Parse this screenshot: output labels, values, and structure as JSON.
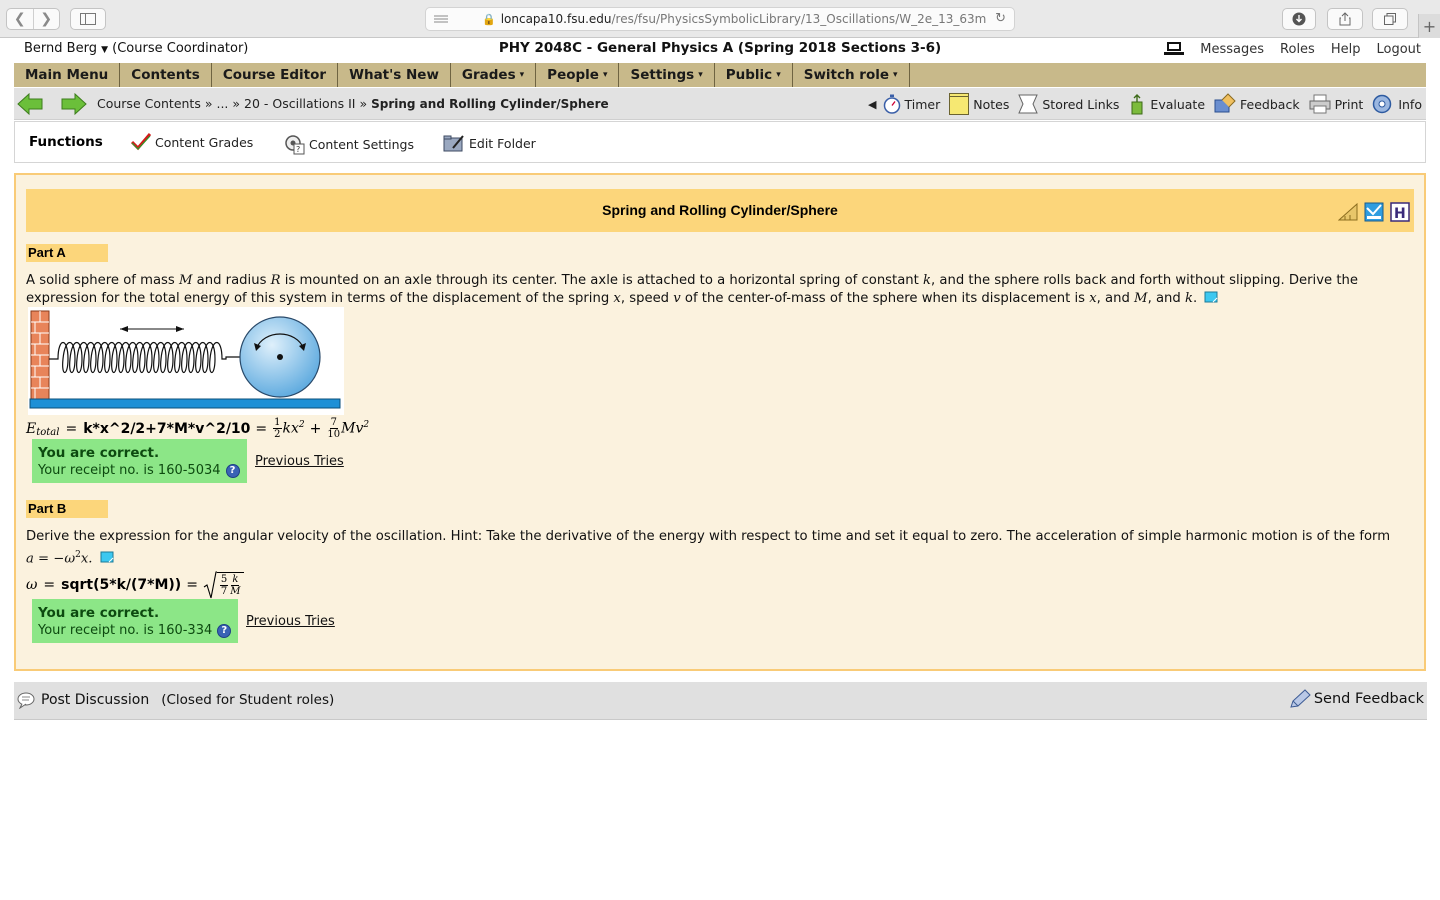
{
  "browser": {
    "url_host": "loncapa10.fsu.edu",
    "url_path": "/res/fsu/PhysicsSymbolicLibrary/13_Oscillations/W_2e_13_63m"
  },
  "header": {
    "user_name": "Bernd Berg",
    "user_role": "(Course Coordinator)",
    "course_title": "PHY 2048C - General Physics A (Spring 2018 Sections 3-6)",
    "links": [
      "Messages",
      "Roles",
      "Help",
      "Logout"
    ]
  },
  "main_menu": [
    {
      "label": "Main Menu",
      "caret": ""
    },
    {
      "label": "Contents",
      "caret": ""
    },
    {
      "label": "Course Editor",
      "caret": ""
    },
    {
      "label": "What's New",
      "caret": ""
    },
    {
      "label": "Grades",
      "caret": "▾"
    },
    {
      "label": "People",
      "caret": "▾"
    },
    {
      "label": "Settings",
      "caret": "▾"
    },
    {
      "label": "Public",
      "caret": "▾"
    },
    {
      "label": "Switch role",
      "caret": "▾"
    }
  ],
  "breadcrumb": {
    "course_contents": "Course Contents",
    "sep": "»",
    "ellipsis": "...",
    "folder": "20 - Oscillations II",
    "current": "Spring and Rolling Cylinder/Sphere"
  },
  "tools": {
    "timer": "Timer",
    "notes": "Notes",
    "stored_links": "Stored Links",
    "evaluate": "Evaluate",
    "feedback": "Feedback",
    "print": "Print",
    "info": "Info"
  },
  "functions": {
    "label": "Functions",
    "content_grades": "Content Grades",
    "content_settings": "Content Settings",
    "edit_folder": "Edit Folder"
  },
  "problem": {
    "title": "Spring and Rolling Cylinder/Sphere",
    "part_a": {
      "label": "Part A",
      "text_1": "A solid sphere of mass ",
      "var_M": "M",
      "text_2": " and radius ",
      "var_R": "R",
      "text_3": " is mounted on an axle through its center. The axle is attached to a horizontal spring of constant ",
      "var_k": "k",
      "text_4": ", and the sphere rolls back and forth without slipping. Derive the expression for the total energy of this system in terms of the displacement of the spring ",
      "var_x": "x",
      "text_5": ", speed ",
      "var_v": "v",
      "text_6": " of the center-of-mass of the sphere when its displacement is ",
      "var_x2": "x",
      "text_7": ", and ",
      "var_M2": "M",
      "text_8": ", and ",
      "var_k2": "k",
      "text_9": ".",
      "answer_lhs": "E",
      "answer_lhs_sub": "total",
      "answer_input": "k*x^2/2+7*M*v^2/10",
      "frac1_n": "1",
      "frac1_d": "2",
      "frac2_n": "7",
      "frac2_d": "10",
      "correct": "You are correct.",
      "receipt": "Your receipt no. is 160-5034",
      "previous_tries": "Previous Tries"
    },
    "part_b": {
      "label": "Part B",
      "text_1": "Derive the expression for the angular velocity of the oscillation. Hint: Take the derivative of the energy with respect to time and set it equal to zero. The acceleration of simple harmonic motion is of the form ",
      "formula": "a = −ω",
      "formula_end": "x.",
      "answer_lhs": "ω",
      "answer_input": "sqrt(5*k/(7*M))",
      "frac1_n": "5",
      "frac1_d": "7",
      "frac2_n": "k",
      "frac2_d": "M",
      "correct": "You are correct.",
      "receipt": "Your receipt no. is 160-334",
      "previous_tries": "Previous Tries"
    }
  },
  "footer": {
    "post_discussion": "Post Discussion",
    "closed_note": "(Closed for Student roles)",
    "send_feedback": "Send Feedback"
  },
  "colors": {
    "menu_bg": "#c8b98a",
    "problem_header": "#fcd67b",
    "content_bg": "#fbf2de",
    "correct_bg": "#8ce687"
  }
}
